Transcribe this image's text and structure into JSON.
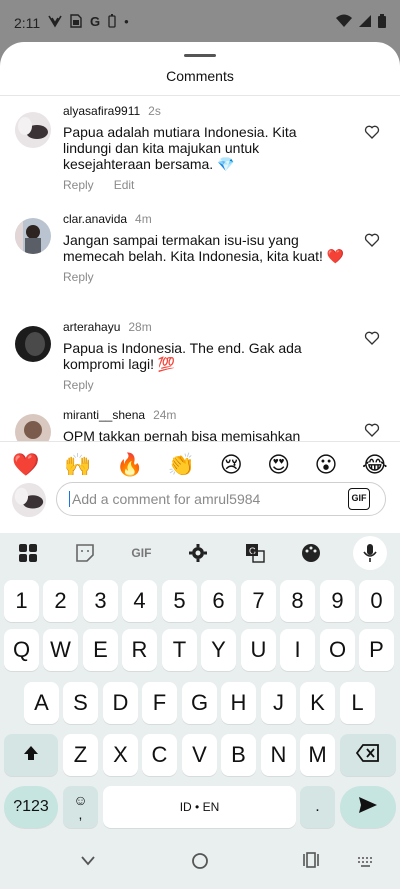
{
  "status": {
    "time": "2:11",
    "left_icons": [
      "vodafone-icon",
      "sim-card-icon",
      "google-icon",
      "battery-saver-icon",
      "dot-icon"
    ],
    "right_icons": [
      "wifi-icon",
      "signal-icon",
      "battery-icon"
    ]
  },
  "sheet": {
    "title": "Comments"
  },
  "comments": [
    {
      "user": "alyasafira9911",
      "time": "2s",
      "text": "Papua adalah mutiara Indonesia. Kita lindungi dan kita majukan untuk kesejahteraan bersama. 💎",
      "actions": [
        "Reply",
        "Edit"
      ]
    },
    {
      "user": "clar.anavida",
      "time": "4m",
      "text": "Jangan sampai termakan isu-isu yang memecah belah. Kita Indonesia, kita kuat! ❤️",
      "actions": [
        "Reply"
      ]
    },
    {
      "user": "arterahayu",
      "time": "28m",
      "text": "Papua is Indonesia. The end. Gak ada kompromi lagi! 💯",
      "actions": [
        "Reply"
      ]
    },
    {
      "user": "miranti__shena",
      "time": "24m",
      "text": "OPM takkan pernah bisa memisahkan",
      "actions": []
    }
  ],
  "emoji_bar": [
    "❤️",
    "🙌",
    "🔥",
    "👏",
    "😢",
    "😍",
    "😮",
    "😂"
  ],
  "compose": {
    "placeholder": "Add a comment for amrul5984",
    "gif_label": "GIF"
  },
  "keyboard": {
    "toolbar": [
      "apps-icon",
      "sticker-icon",
      "gif-icon",
      "settings-icon",
      "translate-icon",
      "palette-icon",
      "mic-icon"
    ],
    "toolbar_gif_label": "GIF",
    "row_numbers": [
      "1",
      "2",
      "3",
      "4",
      "5",
      "6",
      "7",
      "8",
      "9",
      "0"
    ],
    "row_q": [
      "Q",
      "W",
      "E",
      "R",
      "T",
      "Y",
      "U",
      "I",
      "O",
      "P"
    ],
    "row_a": [
      "A",
      "S",
      "D",
      "F",
      "G",
      "H",
      "J",
      "K",
      "L"
    ],
    "row_z": [
      "Z",
      "X",
      "C",
      "V",
      "B",
      "N",
      "M"
    ],
    "symbols_label": "?123",
    "emoji_key_top": "☺",
    "emoji_key_bottom": ",",
    "space_label": "ID • EN",
    "period_label": "."
  },
  "nav": [
    "back-icon",
    "home-icon",
    "recents-icon",
    "keyboard-switch-icon"
  ]
}
